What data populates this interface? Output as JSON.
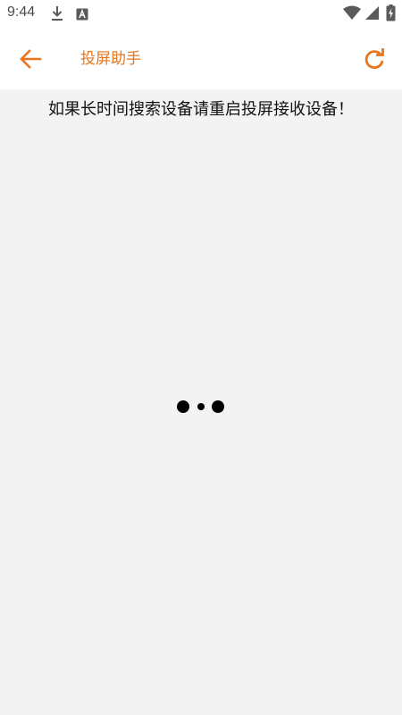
{
  "status_bar": {
    "time": "9:44",
    "icons": [
      "download-icon",
      "notification-a-icon",
      "wifi-icon",
      "signal-icon",
      "battery-charging-icon"
    ]
  },
  "toolbar": {
    "title": "投屏助手",
    "back_icon": "arrow-left-icon",
    "refresh_icon": "refresh-icon",
    "accent_color": "#e8761e"
  },
  "content": {
    "hint": "如果长时间搜索设备请重启投屏接收设备！",
    "background_color": "#f3f3f3",
    "loading_indicator": "three-dot-loader"
  }
}
